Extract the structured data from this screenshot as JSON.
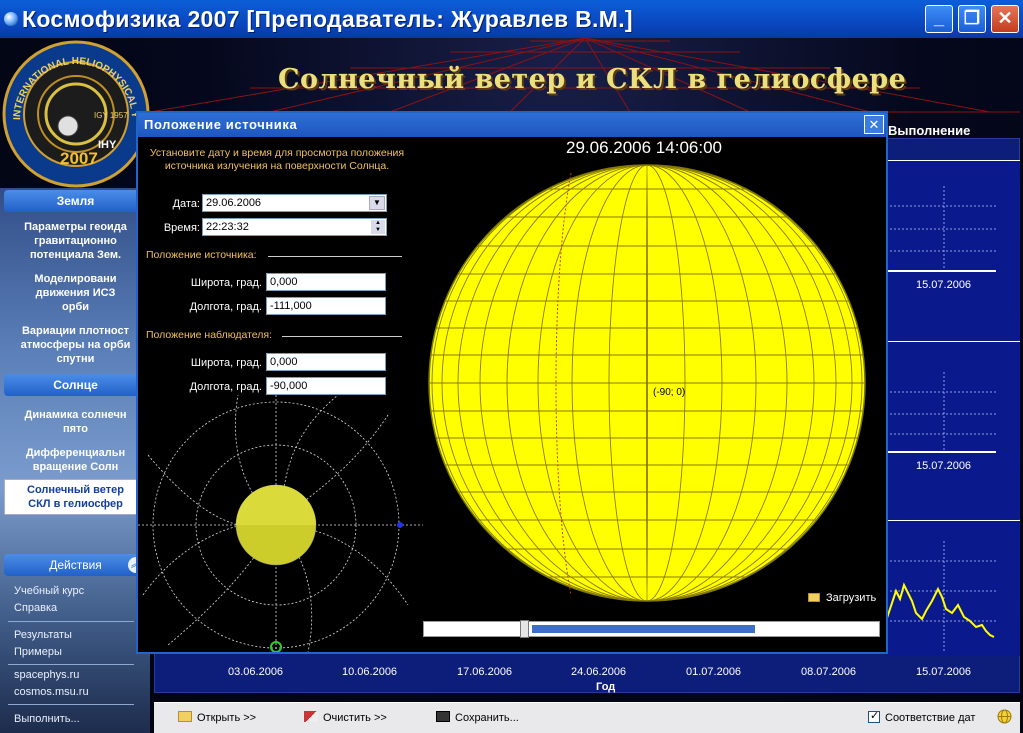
{
  "window": {
    "title": "Космофизика 2007 [Преподаватель: Журавлев В.М.]",
    "buttons": [
      "minimize",
      "maximize",
      "close"
    ]
  },
  "logo": {
    "ring_text": "INTERNATIONAL HELIOPHYSICAL YEAR",
    "sub_text": "IGY 1957",
    "badge": "IHY",
    "year": "2007"
  },
  "main_heading": "Солнечный ветер и СКЛ в гелиосфере",
  "sidebar": {
    "earth_header": "Земля",
    "earth_items": [
      [
        "Параметры геоида",
        "гравитационно",
        "потенциала Зем."
      ],
      [
        "Моделировани",
        "движения ИСЗ",
        "орби"
      ],
      [
        "Вариации плотност",
        "атмосферы на орби",
        "спутни"
      ]
    ],
    "sun_header": "Солнце",
    "sun_items": [
      [
        "Динамика солнечн",
        "пято"
      ],
      [
        "Дифференциальн",
        "вращение Солн"
      ]
    ],
    "active_item": [
      "Солнечный ветер",
      "СКЛ в гелиосфер"
    ],
    "actions_header": "Действия",
    "links": [
      "Учебный курс",
      "Справка",
      "Результаты",
      "Примеры",
      "spacephys.ru",
      "cosmos.msu.ru",
      "Выполнить..."
    ]
  },
  "graph": {
    "partial_title": "Выполнение",
    "panel_dates": [
      "15.07.2006",
      "15.07.2006",
      "15.07.2006"
    ],
    "x_ticks": [
      "03.06.2006",
      "10.06.2006",
      "17.06.2006",
      "24.06.2006",
      "01.07.2006",
      "08.07.2006",
      "15.07.2006"
    ],
    "x_label": "Год"
  },
  "toolbar": {
    "open": "Открыть >>",
    "clear": "Очистить >>",
    "save": "Сохранить...",
    "match_dates": "Соответствие дат",
    "match_dates_checked": true
  },
  "dialog": {
    "title": "Положение источника",
    "hint": "Установите дату и время для просмотра положения источника излучения на поверхности Солнца.",
    "date_label": "Дата:",
    "date_value": "29.06.2006",
    "time_label": "Время:",
    "time_value": "22:23:32",
    "source_section": "Положение источника:",
    "observer_section": "Положение наблюдателя:",
    "lat_label": "Широта, град.",
    "lon_label": "Долгота, град.",
    "source_lat": "0,000",
    "source_lon": "-111,000",
    "observer_lat": "0,000",
    "observer_lon": "-90,000",
    "sun_datetime": "29.06.2006   14:06:00",
    "center_coord": "(-90; 0)",
    "load_label": "Загрузить",
    "slider_position": 0.25,
    "slider_fill_end": 0.74,
    "sun_color": "#ffff00",
    "accent": "#1f66c9"
  }
}
